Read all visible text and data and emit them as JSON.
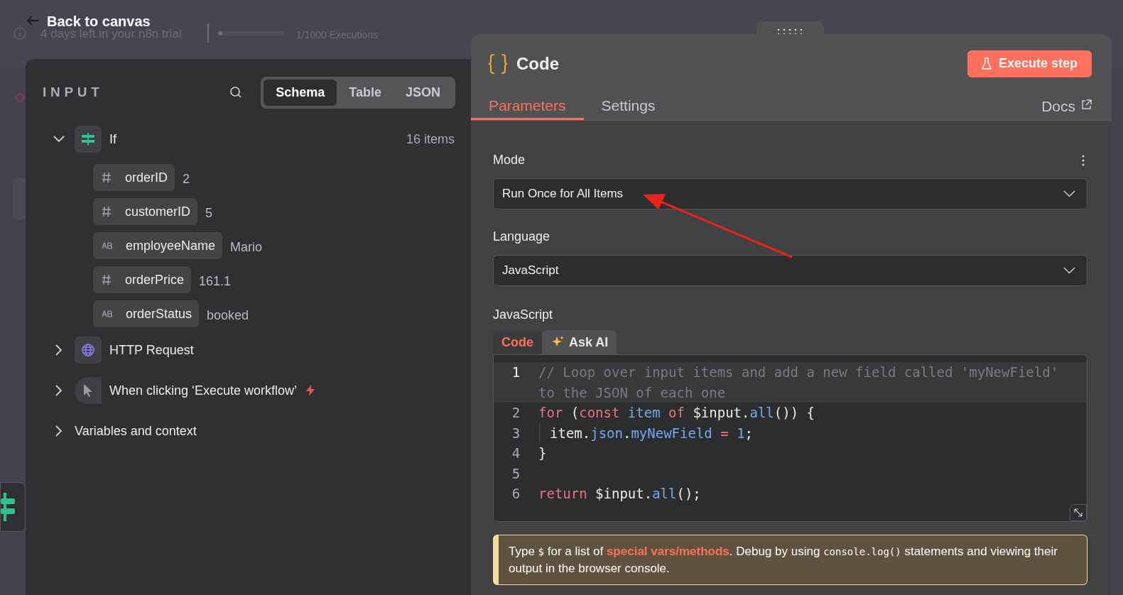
{
  "top_bar": {
    "back_label": "Back to canvas",
    "trial_text": "4 days left in your n8n trial",
    "executions_text": "1/1000 Executions",
    "executions_bar": {
      "level": 0.02
    }
  },
  "input_panel": {
    "title": "INPUT",
    "view_tabs": [
      {
        "label": "Schema",
        "selected": true
      },
      {
        "label": "Table",
        "selected": false
      },
      {
        "label": "JSON",
        "selected": false
      }
    ],
    "tree": [
      {
        "kind": "if",
        "label": "If",
        "expanded": true,
        "count": "16 items",
        "children": [
          {
            "kind": "number",
            "name": "orderID",
            "value": "2"
          },
          {
            "kind": "number",
            "name": "customerID",
            "value": "5"
          },
          {
            "kind": "string",
            "name": "employeeName",
            "value": "Mario"
          },
          {
            "kind": "number",
            "name": "orderPrice",
            "value": "161.1"
          },
          {
            "kind": "string",
            "name": "orderStatus",
            "value": "booked"
          }
        ]
      },
      {
        "kind": "http",
        "label": "HTTP Request",
        "expanded": false
      },
      {
        "kind": "trigger",
        "label": "When clicking ‘Execute workflow’",
        "expanded": false
      },
      {
        "kind": "plain",
        "label": "Variables and context",
        "expanded": false
      }
    ]
  },
  "node_panel": {
    "title": "Code",
    "execute_button": "Execute step",
    "tabs": [
      {
        "label": "Parameters",
        "selected": true
      },
      {
        "label": "Settings",
        "selected": false
      }
    ],
    "docs_link": "Docs",
    "mode": {
      "label": "Mode",
      "value": "Run Once for All Items"
    },
    "language": {
      "label": "Language",
      "value": "JavaScript"
    },
    "code": {
      "label": "JavaScript",
      "tabs": [
        {
          "label": "Code",
          "selected": true
        },
        {
          "label": "Ask AI",
          "selected": false
        }
      ],
      "lines": [
        {
          "number": "1",
          "active": true,
          "tokens": [
            {
              "kind": "comment",
              "text": "// Loop over input items and add a new field called 'myNewField' to the JSON of each one"
            }
          ]
        },
        {
          "number": "2",
          "active": false,
          "tokens": [
            {
              "kind": "keyword",
              "text": "for"
            },
            {
              "kind": "plain",
              "text": " ("
            },
            {
              "kind": "keyword",
              "text": "const "
            },
            {
              "kind": "property",
              "text": "item "
            },
            {
              "kind": "keyword",
              "text": "of"
            },
            {
              "kind": "plain",
              "text": " $input."
            },
            {
              "kind": "property",
              "text": "all"
            },
            {
              "kind": "plain",
              "text": "()) {"
            }
          ]
        },
        {
          "number": "3",
          "active": false,
          "indent": true,
          "tokens": [
            {
              "kind": "plain",
              "text": "item."
            },
            {
              "kind": "property",
              "text": "json"
            },
            {
              "kind": "plain",
              "text": "."
            },
            {
              "kind": "property",
              "text": "myNewField"
            },
            {
              "kind": "keyword",
              "text": " = "
            },
            {
              "kind": "property",
              "text": "1"
            },
            {
              "kind": "plain",
              "text": ";"
            }
          ]
        },
        {
          "number": "4",
          "active": false,
          "tokens": [
            {
              "kind": "plain",
              "text": "}"
            }
          ]
        },
        {
          "number": "5",
          "active": false
        },
        {
          "number": "6",
          "active": false,
          "tokens": [
            {
              "kind": "keyword",
              "text": "return"
            },
            {
              "kind": "plain",
              "text": " $input."
            },
            {
              "kind": "property",
              "text": "all"
            },
            {
              "kind": "plain",
              "text": "();"
            }
          ]
        }
      ]
    },
    "notice": [
      {
        "kind": "text",
        "text": "Type "
      },
      {
        "kind": "code",
        "text": "$"
      },
      {
        "kind": "text",
        "text": " for a list of "
      },
      {
        "kind": "link",
        "text": "special vars/methods"
      },
      {
        "kind": "text",
        "text": ". Debug by using "
      },
      {
        "kind": "code",
        "text": "console.log()"
      },
      {
        "kind": "text",
        "text": " statements and viewing their output in the browser console."
      }
    ]
  }
}
